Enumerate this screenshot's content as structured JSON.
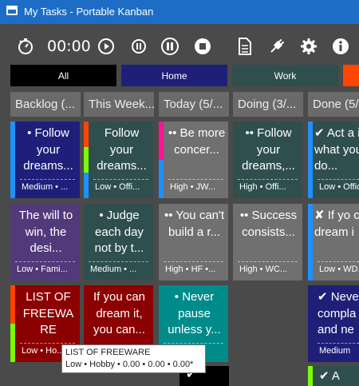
{
  "window": {
    "title": "My Tasks - Portable Kanban"
  },
  "toolbar": {
    "timer": "00:00",
    "icons": [
      "stopwatch-icon",
      "play-icon",
      "pause-small-icon",
      "pause-icon",
      "stop-icon",
      "document-icon",
      "plug-icon",
      "gear-icon",
      "info-icon"
    ]
  },
  "filters": [
    {
      "label": "All",
      "color": "#000000"
    },
    {
      "label": "Home",
      "color": "#1f1f7a"
    },
    {
      "label": "Work",
      "color": "#2f4f4f"
    },
    {
      "label": "",
      "color": "#ff4500"
    }
  ],
  "columns": [
    {
      "label": "Backlog (..."
    },
    {
      "label": "This Week..."
    },
    {
      "label": "Today (5/..."
    },
    {
      "label": "Doing (3/..."
    },
    {
      "label": "Done (5/..."
    }
  ],
  "cards": [
    {
      "text": "• Follow your dreams...",
      "meta": "Medium • ..."
    },
    {
      "text": "Follow your dreams...",
      "meta": "Low • Offi..."
    },
    {
      "text": "•• Be more concer...",
      "meta": "High • JW..."
    },
    {
      "text": "•• Follow your dreams,...",
      "meta": "High • Offi..."
    },
    {
      "text": "✔ Act a if what you do...",
      "meta": "Low • Offic..."
    },
    {
      "text": "The will to win, the desi...",
      "meta": "Low • Fami..."
    },
    {
      "text": "• Judge each day not by t...",
      "meta": "Medium • ..."
    },
    {
      "text": "•• You can't build a r...",
      "meta": "High • HF •..."
    },
    {
      "text": "•• Success consists...",
      "meta": "High • WC..."
    },
    {
      "text": "✘ If yo can dream i",
      "meta": "Low • WD..."
    },
    {
      "text": "LIST OF FREEWA RE",
      "meta": "Low • Ho..."
    },
    {
      "text": "If you can dream it, you can...",
      "meta": ""
    },
    {
      "text": "• Never pause unless y...",
      "meta": ""
    },
    {
      "text": "✔ Neve compla and ne",
      "meta": "Medium"
    },
    {
      "text": "✔ A",
      "meta": ""
    }
  ],
  "tooltip": {
    "title": "LIST OF FREEWARE",
    "details": "Low • Hobby • 0.00 • 0.00 • 0.00*"
  }
}
